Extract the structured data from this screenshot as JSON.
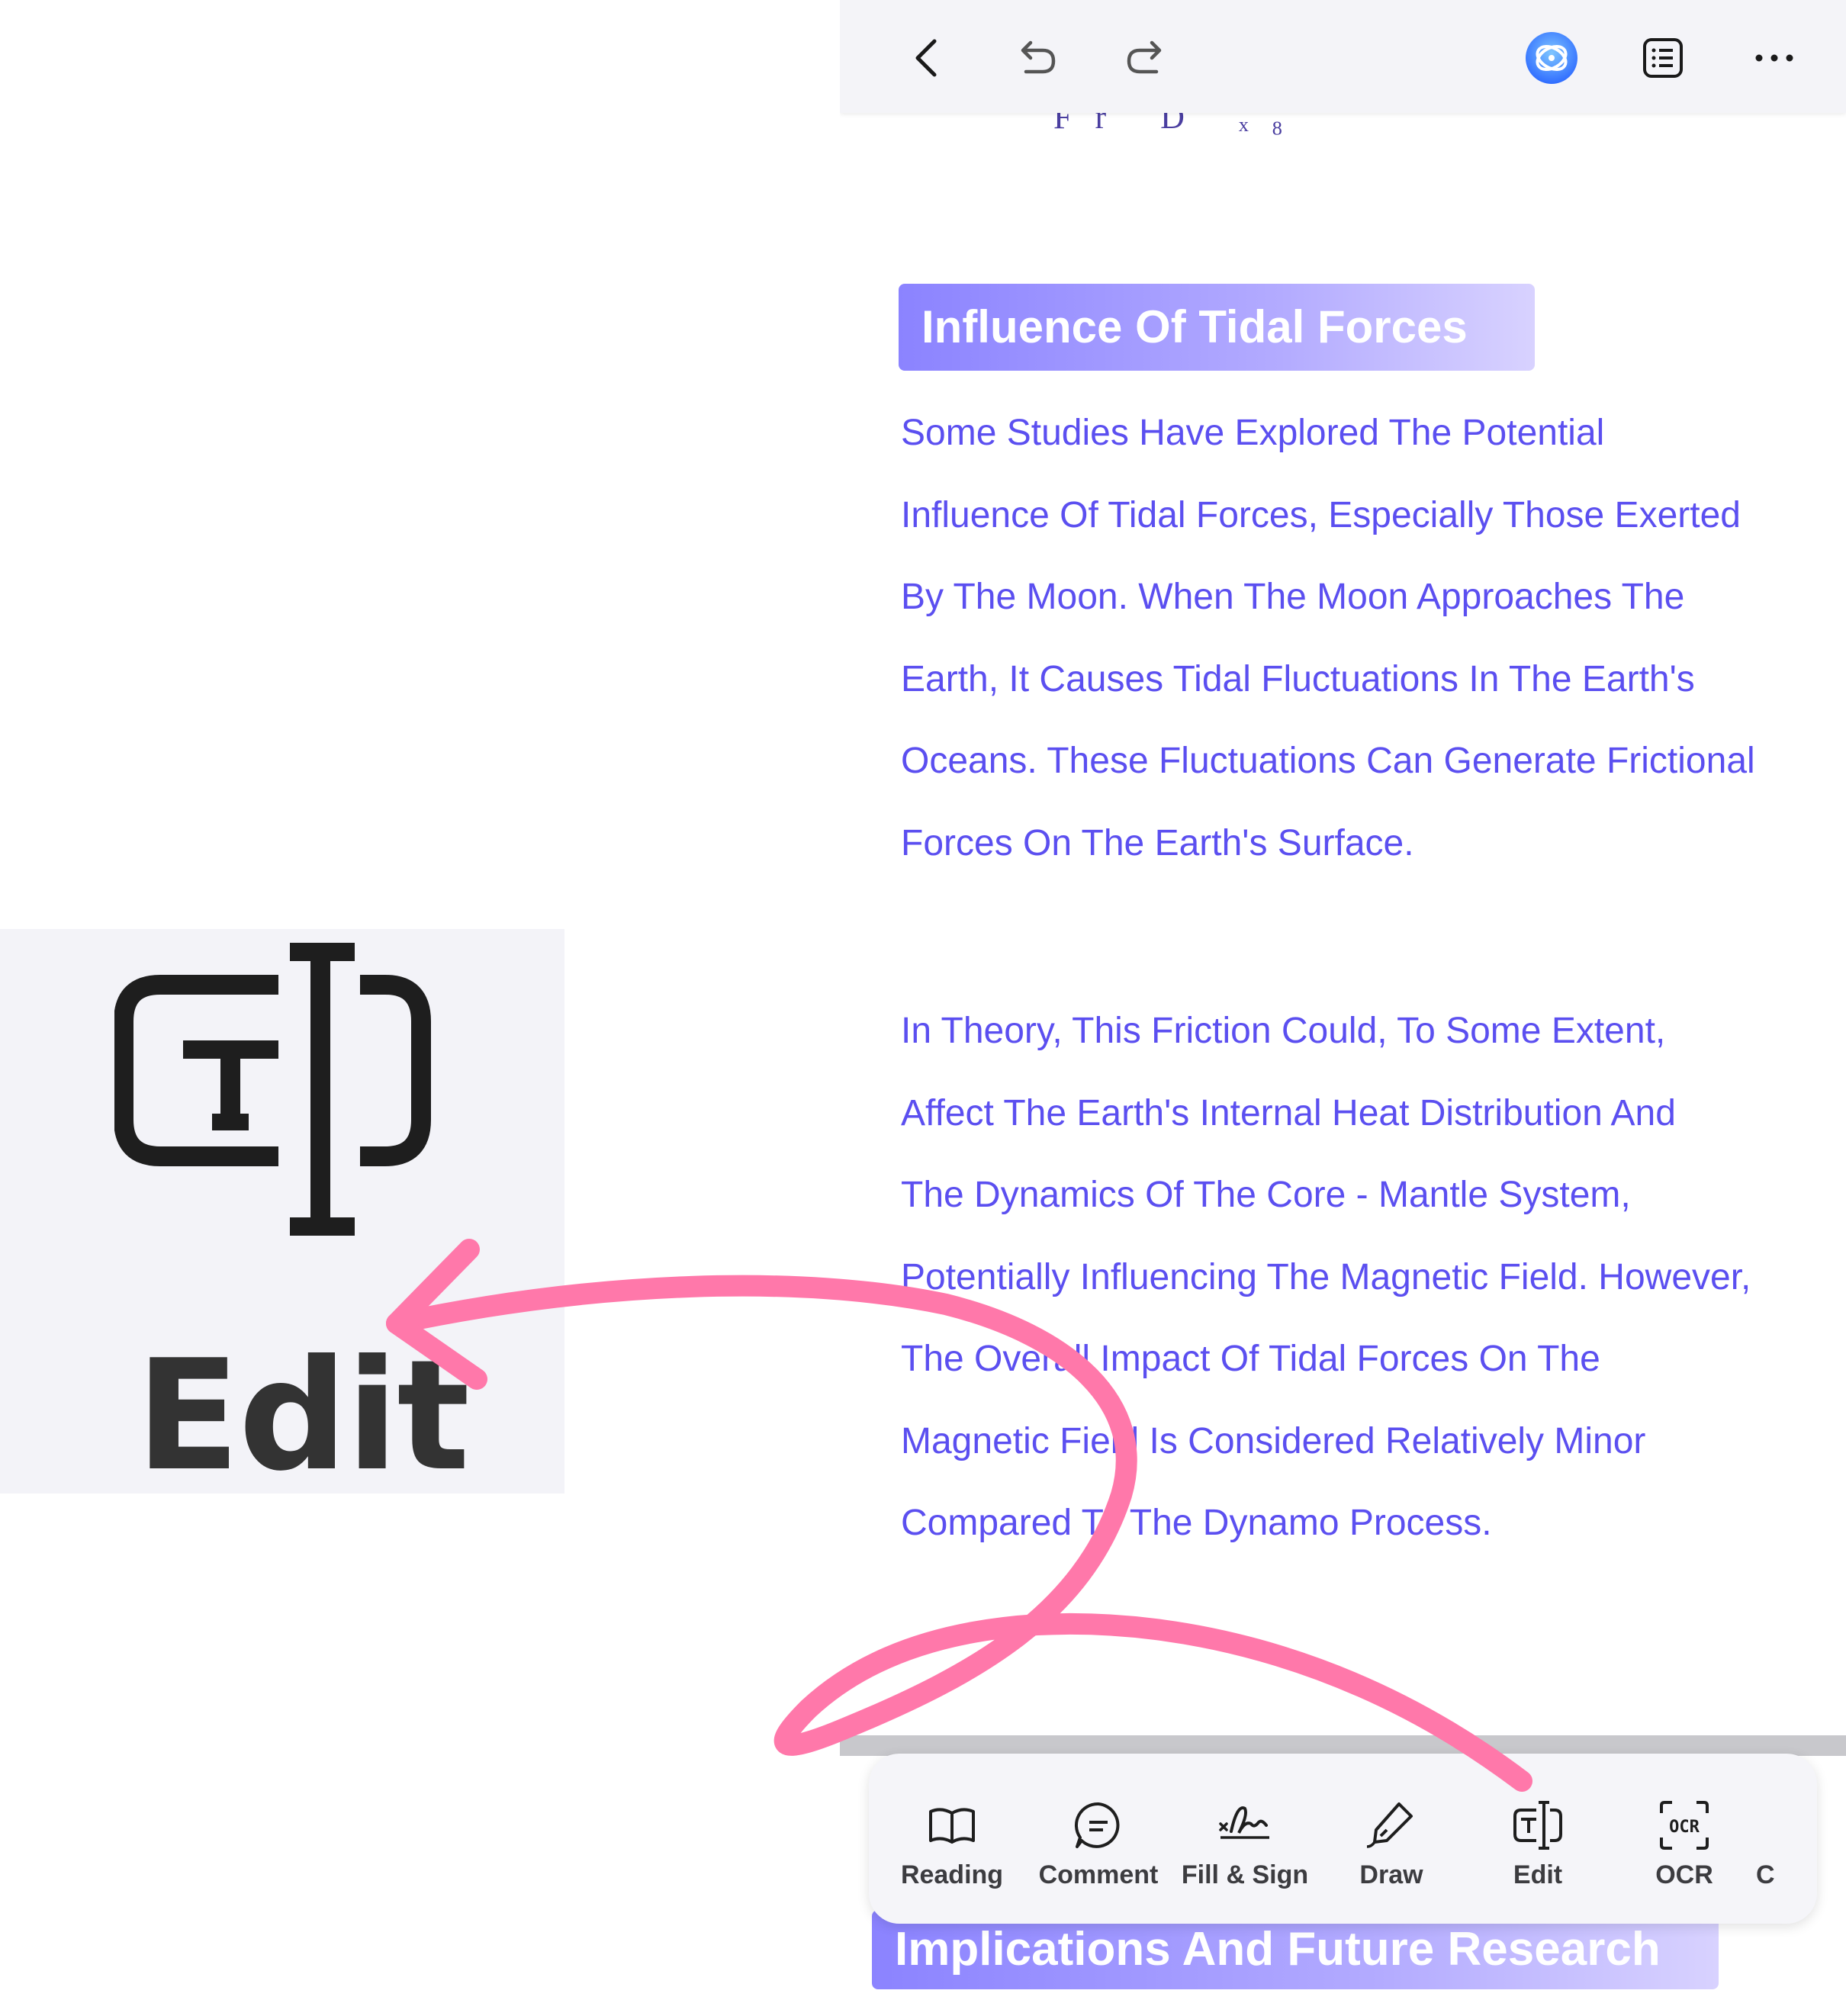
{
  "topbar": {
    "back": "chevron-left-icon",
    "undo": "undo-icon",
    "redo": "redo-icon",
    "ai": "ai-assistant-icon",
    "outline": "outline-list-icon",
    "more": "more-horizontal-icon",
    "accent": "#2b6cff"
  },
  "document": {
    "formula_fragment": "Fr D  ₓ₈",
    "heading_1": "Influence Of Tidal Forces",
    "paragraph_1": [
      "Some Studies Have Explored The Potential",
      "Influence Of Tidal Forces, Especially Those Exerted",
      "By The Moon. When The Moon Approaches The",
      "Earth, It Causes Tidal Fluctuations In The Earth's",
      "Oceans. These Fluctuations Can Generate Frictional",
      "Forces On The Earth's Surface."
    ],
    "paragraph_2": [
      " In Theory, This Friction Could, To Some Extent,",
      "Affect The Earth's Internal Heat Distribution And",
      "The Dynamics Of The Core - Mantle System,",
      "Potentially Influencing The Magnetic Field. However,",
      "The Overall Impact Of Tidal Forces On The",
      "Magnetic Field Is Considered Relatively Minor",
      "Compared To The Dynamo Process."
    ],
    "heading_2": "Implications And Future Research",
    "text_color": "#5b4ff0",
    "heading_gradient": [
      "#8b83ff",
      "#d8d2ff"
    ]
  },
  "toolbar": {
    "tools": [
      {
        "label": "Reading",
        "icon": "book-open-icon"
      },
      {
        "label": "Comment",
        "icon": "comment-bubble-icon"
      },
      {
        "label": "Fill & Sign",
        "icon": "signature-icon"
      },
      {
        "label": "Draw",
        "icon": "pen-icon"
      },
      {
        "label": "Edit",
        "icon": "text-edit-icon"
      },
      {
        "label": "OCR",
        "icon": "ocr-icon"
      },
      {
        "label": "C",
        "icon": ""
      }
    ]
  },
  "callout": {
    "label": "Edit",
    "icon": "text-edit-icon",
    "arrow_color": "#ff78aa"
  }
}
